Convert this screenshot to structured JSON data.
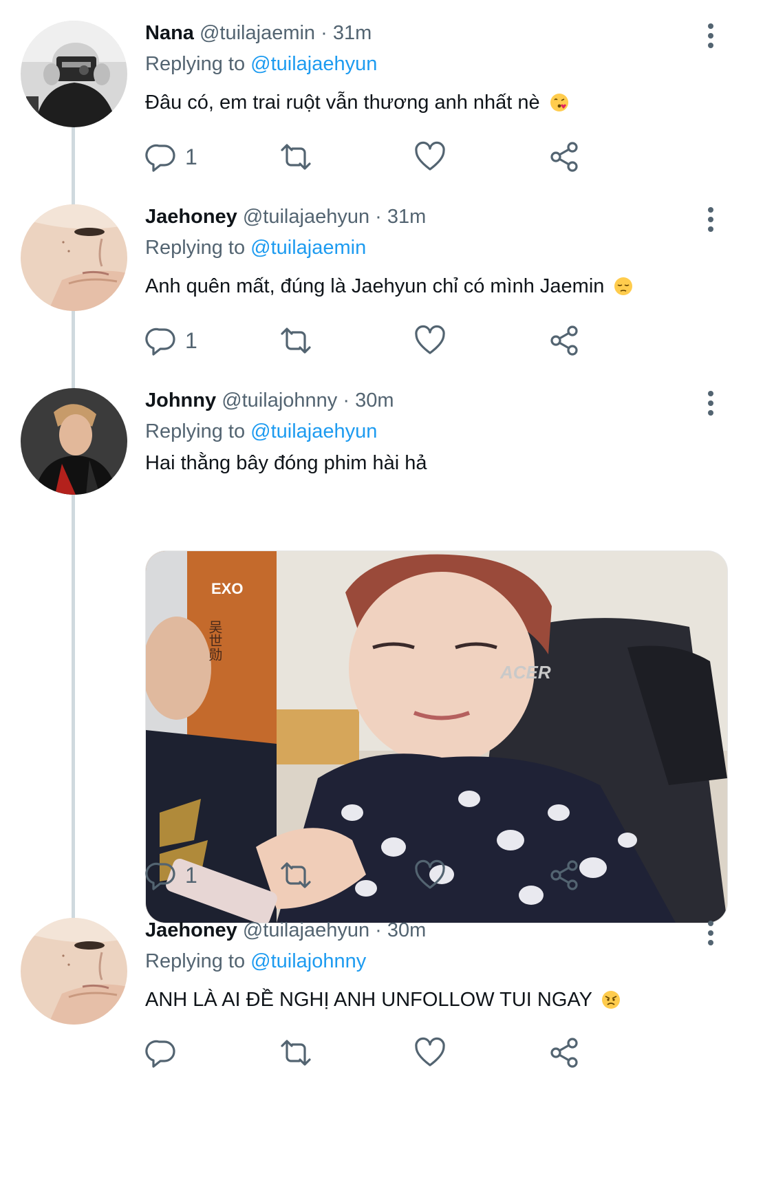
{
  "tweets": [
    {
      "name": "Nana",
      "handle": "@tuilajaemin",
      "time": "31m",
      "replying_prefix": "Replying to",
      "replying_handle": "@tuilajaehyun",
      "text": "Đâu có, em trai ruột vẫn thương anh nhất nè",
      "emoji": "face-blowing-kiss-emoji",
      "reply_count": "1"
    },
    {
      "name": "Jaehoney",
      "handle": "@tuilajaehyun",
      "time": "31m",
      "replying_prefix": "Replying to",
      "replying_handle": "@tuilajaemin",
      "text": "Anh quên mất, đúng là Jaehyun chỉ có mình Jaemin",
      "emoji": "pensive-face-emoji",
      "reply_count": "1"
    },
    {
      "name": "Johnny",
      "handle": "@tuilajohnny",
      "time": "30m",
      "replying_prefix": "Replying to",
      "replying_handle": "@tuilajaehyun",
      "text": "Hai thằng bây đóng phim hài hả",
      "media": {
        "poster_text_1": "EXO",
        "poster_text_2": "吴世勋",
        "chair_brand": "ACER"
      },
      "reply_count": "1"
    },
    {
      "name": "Jaehoney",
      "handle": "@tuilajaehyun",
      "time": "30m",
      "replying_prefix": "Replying to",
      "replying_handle": "@tuilajohnny",
      "text": "ANH LÀ AI ĐỀ NGHỊ ANH UNFOLLOW TUI NGAY",
      "emoji": "angry-face-emoji",
      "reply_count": ""
    }
  ],
  "separator": "·",
  "colors": {
    "link": "#1d9bf0",
    "secondary_text": "#536471",
    "primary_text": "#0f1419",
    "thread_line": "#cfd9de"
  }
}
